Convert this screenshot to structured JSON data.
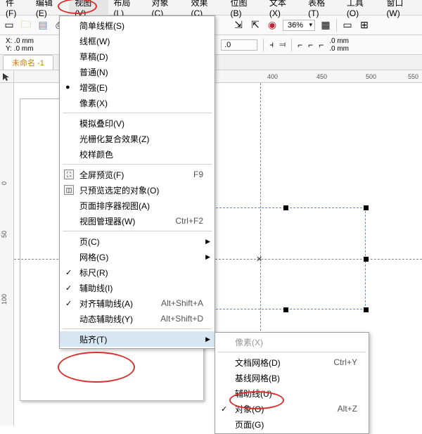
{
  "menubar": {
    "items": [
      "件(F)",
      "编辑(E)",
      "视图(V)",
      "布局(L)",
      "对象(C)",
      "效果(C)",
      "位图(B)",
      "文本(X)",
      "表格(T)",
      "工具(O)",
      "窗口(W)"
    ],
    "active_index": 2
  },
  "toolbar": {
    "zoom": "36%",
    "coord_x": "X: .0 mm",
    "coord_y": "Y: .0 mm",
    "angle_value": ".0",
    "size_top": ".0 mm",
    "size_bot": ".0 mm"
  },
  "tab": {
    "label": "未命名 -1"
  },
  "ruler_h": [
    "400",
    "450",
    "500",
    "550"
  ],
  "ruler_v": [
    "0",
    "50",
    "100"
  ],
  "menu_view": {
    "items": [
      {
        "label": "简单线框(S)"
      },
      {
        "label": "线框(W)"
      },
      {
        "label": "草稿(D)"
      },
      {
        "label": "普通(N)"
      },
      {
        "label": "增强(E)",
        "bullet": true
      },
      {
        "label": "像素(X)"
      },
      {
        "sep": true
      },
      {
        "label": "模拟叠印(V)"
      },
      {
        "label": "光栅化复合效果(Z)"
      },
      {
        "label": "校样颜色"
      },
      {
        "sep": true
      },
      {
        "label": "全屏预览(F)",
        "shortcut": "F9",
        "icon": true
      },
      {
        "label": "只预览选定的对象(O)",
        "icon": true
      },
      {
        "label": "页面排序器视图(A)"
      },
      {
        "label": "视图管理器(W)",
        "shortcut": "Ctrl+F2"
      },
      {
        "sep": true
      },
      {
        "label": "页(C)",
        "arrow": true
      },
      {
        "label": "网格(G)",
        "arrow": true
      },
      {
        "label": "标尺(R)",
        "check": true
      },
      {
        "label": "辅助线(I)",
        "check": true
      },
      {
        "label": "对齐辅助线(A)",
        "shortcut": "Alt+Shift+A",
        "check": true
      },
      {
        "label": "动态辅助线(Y)",
        "shortcut": "Alt+Shift+D"
      },
      {
        "sep": true
      },
      {
        "label": "贴齐(T)",
        "arrow": true,
        "highlighted": true
      }
    ]
  },
  "menu_snap": {
    "items": [
      {
        "label": "像素(X)",
        "disabled": true
      },
      {
        "sep": true
      },
      {
        "label": "文档网格(D)",
        "shortcut": "Ctrl+Y"
      },
      {
        "label": "基线网格(B)"
      },
      {
        "label": "辅助线(U)"
      },
      {
        "label": "对象(O)",
        "shortcut": "Alt+Z",
        "check": true
      },
      {
        "label": "页面(G)"
      }
    ]
  }
}
